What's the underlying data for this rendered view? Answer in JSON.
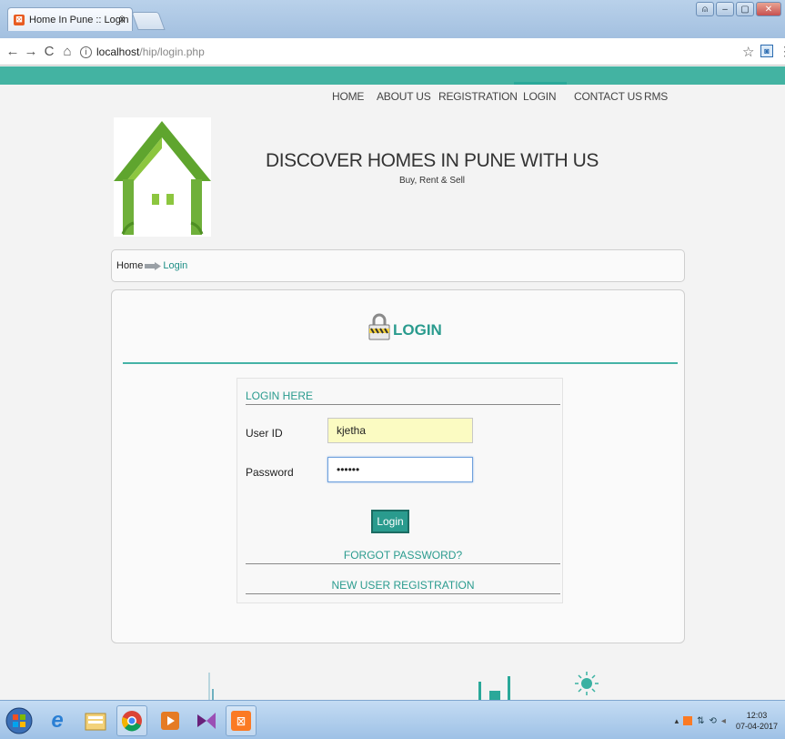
{
  "browser": {
    "tab_title": "Home In Pune :: Login",
    "tab_close": "x",
    "url_host": "localhost",
    "url_path": "/hip/login.php",
    "nav": {
      "back": "←",
      "forward": "→",
      "reload": "C",
      "home": "⌂"
    }
  },
  "site": {
    "nav": [
      "HOME",
      "ABOUT US",
      "REGISTRATION",
      "LOGIN",
      "CONTACT US",
      "RMS"
    ],
    "active_nav": "LOGIN",
    "tagline": "DISCOVER HOMES IN PUNE WITH US",
    "subtagline": "Buy, Rent & Sell",
    "breadcrumb": {
      "home": "Home",
      "current": "Login"
    }
  },
  "login": {
    "heading": "LOGIN",
    "box_title": "LOGIN HERE",
    "user_label": "User ID",
    "user_value": "kjetha",
    "password_label": "Password",
    "password_value": "••••••",
    "button_label": "Login",
    "forgot_link": "FORGOT PASSWORD?",
    "register_link": "NEW USER REGISTRATION"
  },
  "taskbar": {
    "clock_time": "12:03",
    "clock_date": "07-04-2017"
  },
  "colors": {
    "accent": "#2a9b8e",
    "top_strip": "#43b3a2",
    "logo_green": "#6fb03a"
  }
}
